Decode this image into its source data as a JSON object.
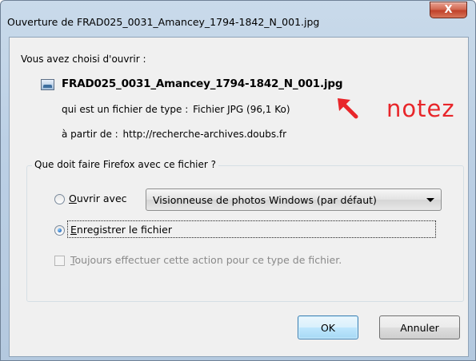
{
  "window": {
    "title": "Ouverture de FRAD025_0031_Amancey_1794-1842_N_001.jpg",
    "close_glyph": "X"
  },
  "dialog": {
    "chose_label": "Vous avez choisi d'ouvrir :",
    "file_icon": "image-file-icon",
    "file_name": "FRAD025_0031_Amancey_1794-1842_N_001.jpg",
    "type_label": "qui est un fichier de type :",
    "type_value": "Fichier JPG (96,1 Ko)",
    "from_label": "à partir de :",
    "from_value": "http://recherche-archives.doubs.fr"
  },
  "annotation": {
    "arrow_icon": "red-arrow-icon",
    "text": "notez",
    "color": "#e8262a"
  },
  "group": {
    "label": "Que doit faire Firefox avec ce fichier ?",
    "open_with": {
      "accesskey": "O",
      "rest": "uvrir avec",
      "selected": false,
      "app_selected": "Visionneuse de photos Windows (par défaut)"
    },
    "save_file": {
      "accesskey": "E",
      "rest": "nregistrer le fichier",
      "selected": true
    },
    "always": {
      "accesskey": "T",
      "rest": "oujours effectuer cette action pour ce type de fichier.",
      "checked": false,
      "enabled": false
    }
  },
  "buttons": {
    "ok": "OK",
    "cancel": "Annuler"
  }
}
